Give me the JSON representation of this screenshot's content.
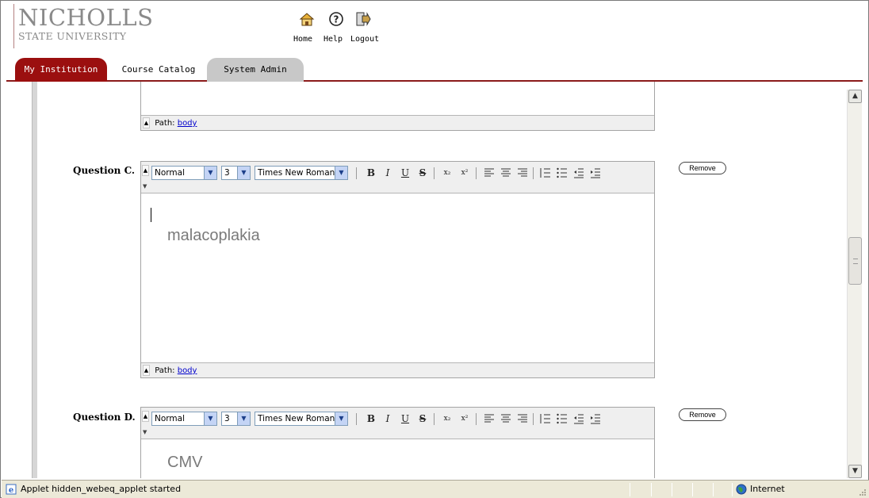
{
  "logo": {
    "line1": "NICHOLLS",
    "line2": "STATE UNIVERSITY"
  },
  "topnav": [
    {
      "label": "Home",
      "icon": "home-icon"
    },
    {
      "label": "Help",
      "icon": "help-icon"
    },
    {
      "label": "Logout",
      "icon": "logout-icon"
    }
  ],
  "tabs": [
    {
      "label": "My Institution",
      "active": true
    },
    {
      "label": "Course Catalog",
      "active": false
    },
    {
      "label": "System Admin",
      "active": false
    }
  ],
  "editor_prev": {
    "path_label": "Path:",
    "path_link": "body"
  },
  "question_c": {
    "label": "Question C.",
    "format": "Normal",
    "size": "3",
    "font": "Times New Roman",
    "content": "malacoplakia",
    "path_label": "Path:",
    "path_link": "body",
    "remove_label": "Remove"
  },
  "question_d": {
    "label": "Question D.",
    "format": "Normal",
    "size": "3",
    "font": "Times New Roman",
    "content": "CMV",
    "remove_label": "Remove"
  },
  "toolbar_buttons": {
    "bold": "B",
    "italic": "I",
    "underline": "U",
    "strike": "S",
    "subscript": "x₂",
    "superscript": "x²"
  },
  "statusbar": {
    "text": "Applet hidden_webeq_applet started",
    "zone": "Internet"
  },
  "colors": {
    "tab_active": "#9b0f0f",
    "link": "#0000cc",
    "text_gray": "#7a7a7a"
  }
}
